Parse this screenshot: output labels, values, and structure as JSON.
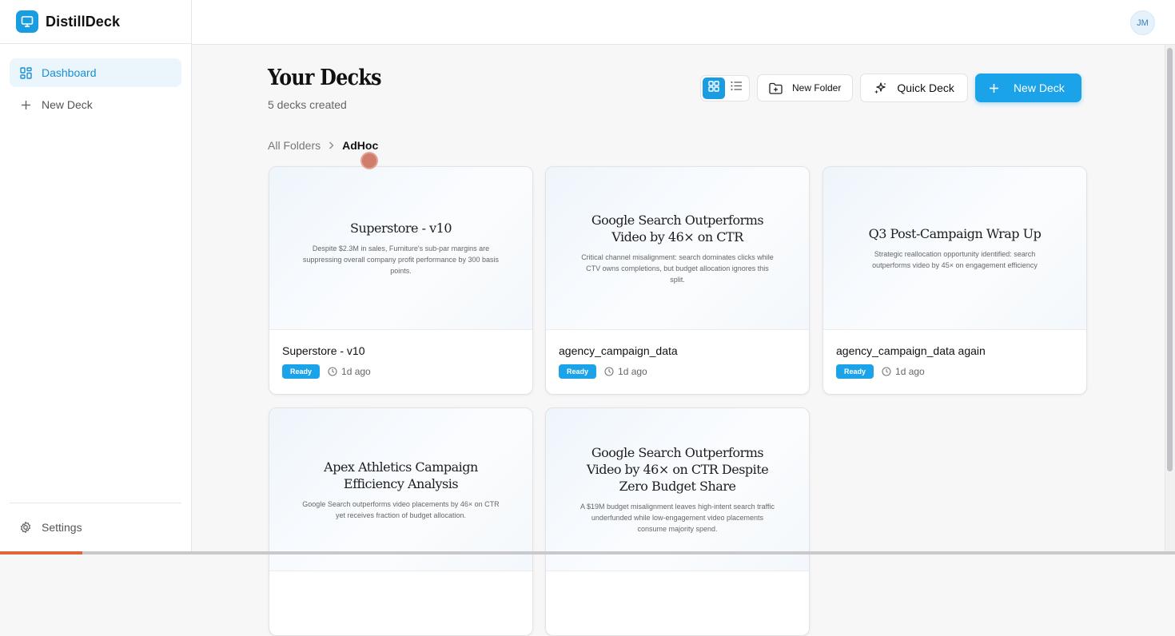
{
  "app": {
    "name": "DistillDeck"
  },
  "sidebar": {
    "items": [
      {
        "label": "Dashboard",
        "icon": "dashboard-grid-icon",
        "active": true
      },
      {
        "label": "New Deck",
        "icon": "plus-icon",
        "active": false
      }
    ],
    "settings_label": "Settings"
  },
  "user": {
    "initials": "JM"
  },
  "page": {
    "title": "Your Decks",
    "subtitle": "5 decks created"
  },
  "toolbar": {
    "view_modes": [
      "grid",
      "list"
    ],
    "active_view": "grid",
    "new_folder_label": "New Folder",
    "quick_deck_label": "Quick Deck",
    "new_deck_label": "New Deck"
  },
  "breadcrumb": {
    "root": "All Folders",
    "current": "AdHoc"
  },
  "decks": [
    {
      "preview_title": "Superstore - v10",
      "preview_subtitle": "Despite $2.3M in sales, Furniture's sub-par margins are suppressing overall company profit performance by 300 basis points.",
      "name": "Superstore - v10",
      "status": "Ready",
      "time": "1d ago"
    },
    {
      "preview_title": "Google Search Outperforms Video by 46× on CTR",
      "preview_subtitle": "Critical channel misalignment: search dominates clicks while CTV owns completions, but budget allocation ignores this split.",
      "name": "agency_campaign_data",
      "status": "Ready",
      "time": "1d ago"
    },
    {
      "preview_title": "Q3 Post-Campaign Wrap Up",
      "preview_subtitle": "Strategic reallocation opportunity identified: search outperforms video by 45× on engagement efficiency",
      "name": "agency_campaign_data again",
      "status": "Ready",
      "time": "1d ago"
    },
    {
      "preview_title": "Apex Athletics Campaign Efficiency Analysis",
      "preview_subtitle": "Google Search outperforms video placements by 46× on CTR yet receives fraction of budget allocation.",
      "name": "",
      "status": "",
      "time": ""
    },
    {
      "preview_title": "Google Search Outperforms Video by 46× on CTR Despite Zero Budget Share",
      "preview_subtitle": "A $19M budget misalignment leaves high-intent search traffic underfunded while low-engagement video placements consume majority spend.",
      "name": "",
      "status": "",
      "time": ""
    }
  ],
  "colors": {
    "accent": "#1aa3e8",
    "active_nav_bg": "#eaf5fc",
    "progress": "#e0653a"
  },
  "loading_progress": 0.07
}
